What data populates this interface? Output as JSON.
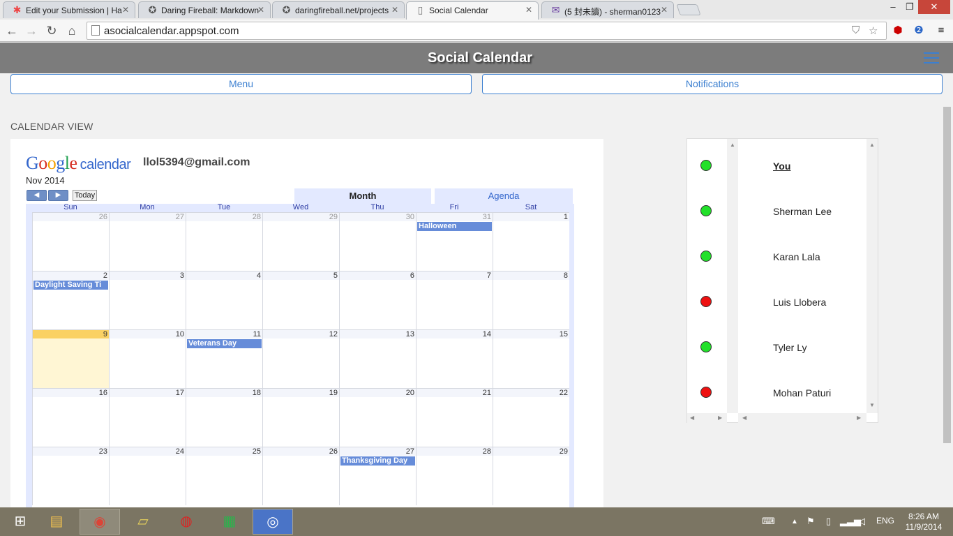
{
  "browser": {
    "tabs": [
      {
        "title": "Edit your Submission | Ha",
        "icon": "pinwheel-icon"
      },
      {
        "title": "Daring Fireball: Markdown",
        "icon": "star-icon"
      },
      {
        "title": "daringfireball.net/projects",
        "icon": "star-icon"
      },
      {
        "title": "Social Calendar",
        "icon": "page-icon",
        "active": true
      },
      {
        "title": "(5 封未讀) - sherman0123",
        "icon": "mail-icon"
      }
    ],
    "url": "asocialcalendar.appspot.com"
  },
  "app": {
    "title": "Social Calendar",
    "menu_label": "Menu",
    "notifications_label": "Notifications",
    "section_title": "CALENDAR VIEW"
  },
  "calendar": {
    "logo_google": "Google",
    "logo_calendar": "calendar",
    "email": "llol5394@gmail.com",
    "month_label": "Nov 2014",
    "today_label": "Today",
    "tab_month": "Month",
    "tab_agenda": "Agenda",
    "day_names": [
      "Sun",
      "Mon",
      "Tue",
      "Wed",
      "Thu",
      "Fri",
      "Sat"
    ],
    "weeks": [
      [
        {
          "d": "26",
          "o": true
        },
        {
          "d": "27",
          "o": true
        },
        {
          "d": "28",
          "o": true
        },
        {
          "d": "29",
          "o": true
        },
        {
          "d": "30",
          "o": true
        },
        {
          "d": "31",
          "o": true,
          "e": "Halloween"
        },
        {
          "d": "1"
        }
      ],
      [
        {
          "d": "2",
          "e": "Daylight Saving Ti"
        },
        {
          "d": "3"
        },
        {
          "d": "4"
        },
        {
          "d": "5"
        },
        {
          "d": "6"
        },
        {
          "d": "7"
        },
        {
          "d": "8"
        }
      ],
      [
        {
          "d": "9",
          "t": true
        },
        {
          "d": "10"
        },
        {
          "d": "11",
          "e": "Veterans Day"
        },
        {
          "d": "12"
        },
        {
          "d": "13"
        },
        {
          "d": "14"
        },
        {
          "d": "15"
        }
      ],
      [
        {
          "d": "16"
        },
        {
          "d": "17"
        },
        {
          "d": "18"
        },
        {
          "d": "19"
        },
        {
          "d": "20"
        },
        {
          "d": "21"
        },
        {
          "d": "22"
        }
      ],
      [
        {
          "d": "23"
        },
        {
          "d": "24"
        },
        {
          "d": "25"
        },
        {
          "d": "26"
        },
        {
          "d": "27",
          "e": "Thanksgiving Day"
        },
        {
          "d": "28"
        },
        {
          "d": "29"
        }
      ]
    ],
    "colors": {
      "event": "#668cd9",
      "today": "#fad163",
      "today_bg": "#fff6d4"
    }
  },
  "friends": [
    {
      "name": "You",
      "status": "online",
      "color": "#22e02a"
    },
    {
      "name": "Sherman Lee",
      "status": "online",
      "color": "#22e02a"
    },
    {
      "name": "Karan Lala",
      "status": "online",
      "color": "#22e02a"
    },
    {
      "name": "Luis Llobera",
      "status": "busy",
      "color": "#ee1111"
    },
    {
      "name": "Tyler Ly",
      "status": "online",
      "color": "#22e02a"
    },
    {
      "name": "Mohan Paturi",
      "status": "busy",
      "color": "#ee1111"
    }
  ],
  "taskbar": {
    "lang": "ENG",
    "time": "8:26 AM",
    "date": "11/9/2014"
  }
}
